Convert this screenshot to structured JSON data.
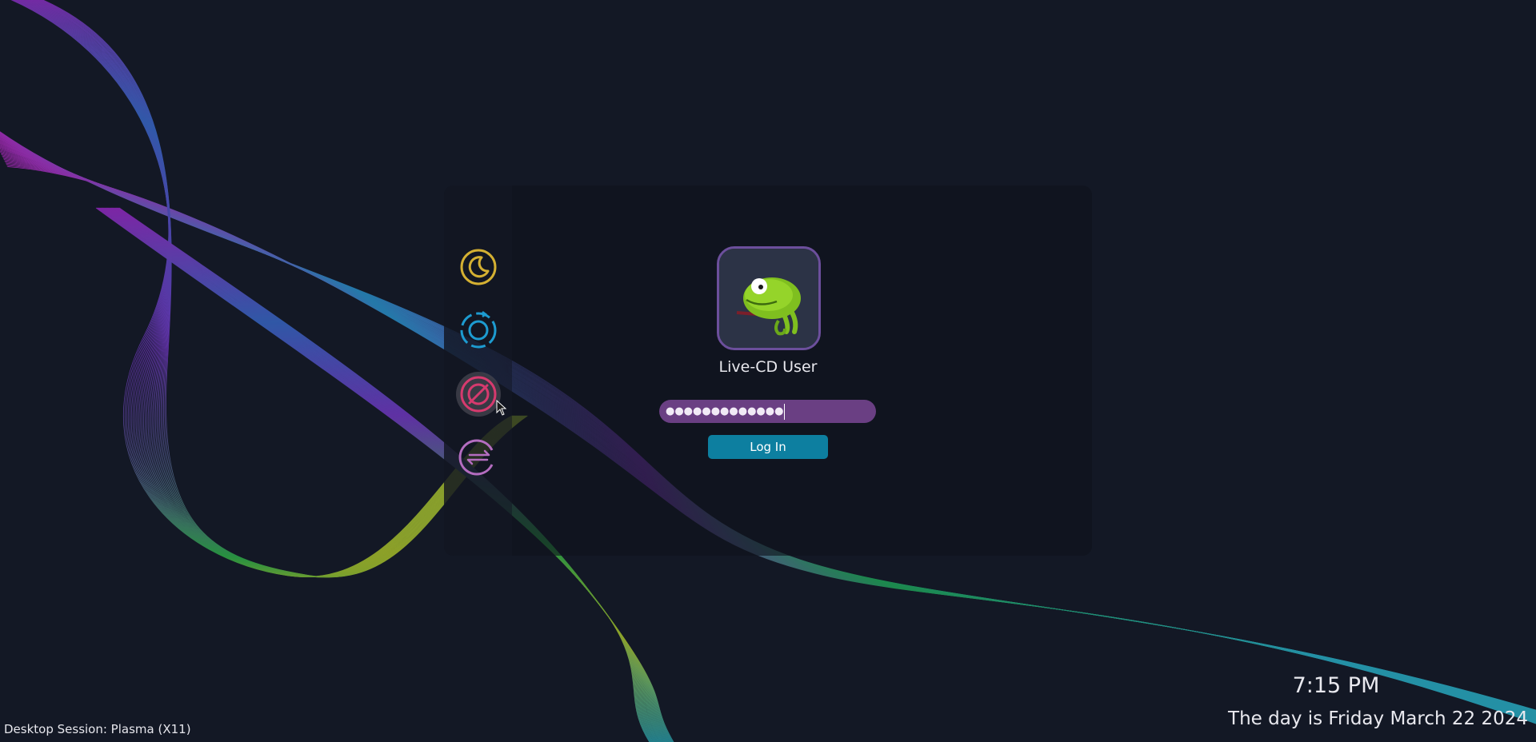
{
  "theme": {
    "background": "#131825",
    "panel": "#0e111b",
    "accent_purple": "#6a3f83",
    "accent_blue": "#0d7fa0",
    "suspend_color": "#d4b032",
    "restart_color": "#1d9bd0",
    "shutdown_color": "#d63a6e",
    "switch_color": "#b46dc0"
  },
  "power_buttons": [
    {
      "action": "suspend",
      "icon": "moon-icon"
    },
    {
      "action": "restart",
      "icon": "restart-icon"
    },
    {
      "action": "shutdown",
      "icon": "power-icon"
    },
    {
      "action": "switch_user",
      "icon": "switch-arrows-icon"
    }
  ],
  "user": {
    "name": "Live-CD User",
    "avatar_icon": "chameleon-avatar"
  },
  "password": {
    "masked_value": "●●●●●●●●●●●●●"
  },
  "login_button": {
    "label": "Log In"
  },
  "session": {
    "label": "Desktop Session: Plasma (X11)"
  },
  "clock": {
    "time": "7:15 PM",
    "date": "The day is Friday March 22 2024"
  }
}
